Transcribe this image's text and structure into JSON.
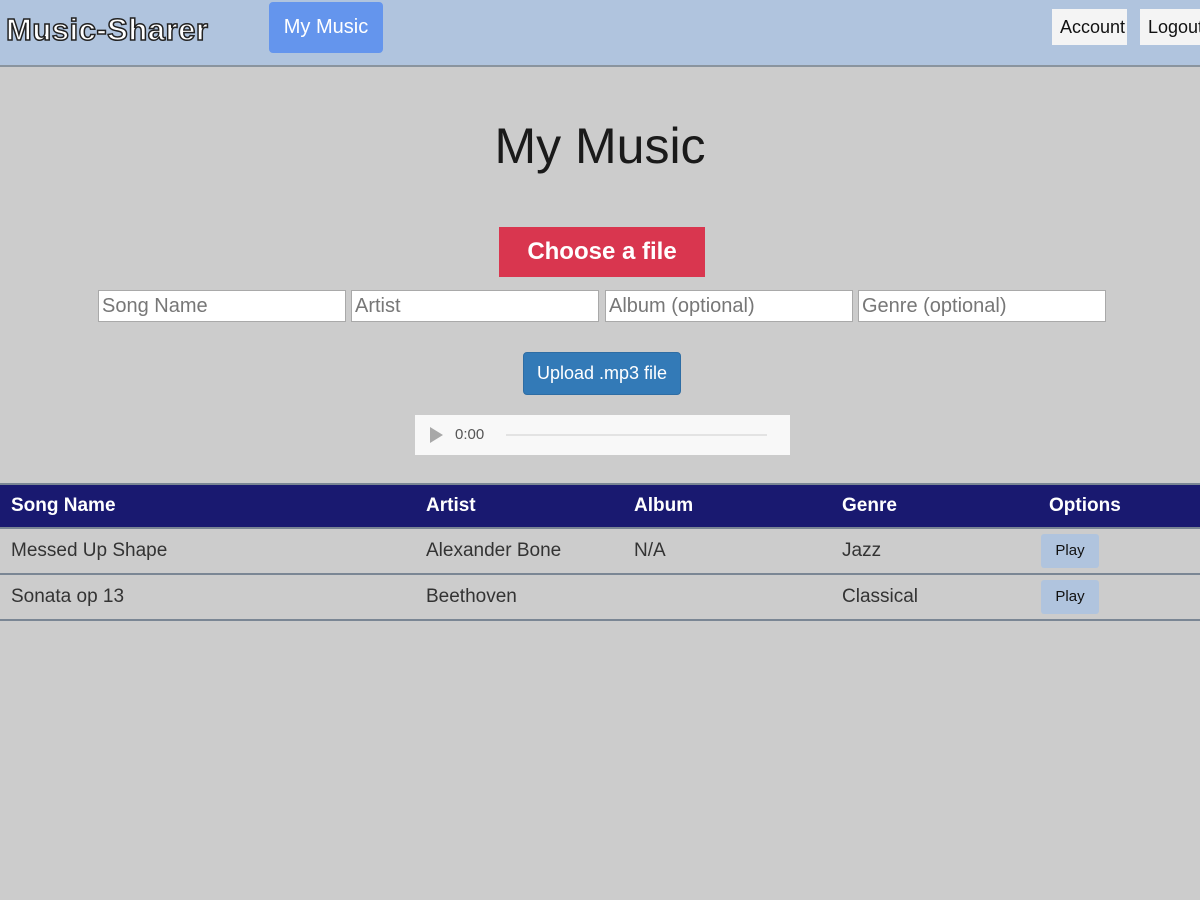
{
  "navbar": {
    "brand": "Music-Sharer",
    "my_music_link": "My Music",
    "account_link": "Account",
    "logout_link": "Logout"
  },
  "main": {
    "title": "My Music",
    "choose_file_label": "Choose a file",
    "fields": {
      "song_name_placeholder": "Song Name",
      "artist_placeholder": "Artist",
      "album_placeholder": "Album (optional)",
      "genre_placeholder": "Genre (optional)"
    },
    "upload_button": "Upload .mp3 file",
    "audio_player": {
      "time": "0:00",
      "play_icon": "play-icon"
    }
  },
  "table": {
    "headers": [
      "Song Name",
      "Artist",
      "Album",
      "Genre",
      "Options"
    ],
    "rows": [
      {
        "song": "Messed Up Shape",
        "artist": "Alexander Bone",
        "album": "N/A",
        "genre": "Jazz",
        "option": "Play"
      },
      {
        "song": "Sonata op 13",
        "artist": "Beethoven",
        "album": "",
        "genre": "Classical",
        "option": "Play"
      }
    ]
  },
  "colors": {
    "navbar_bg": "#b0c4de",
    "active_nav": "#6495ed",
    "choose_file": "#d9364f",
    "upload_button": "#337ab7",
    "table_header": "#191970",
    "page_bg": "#cccccc"
  }
}
